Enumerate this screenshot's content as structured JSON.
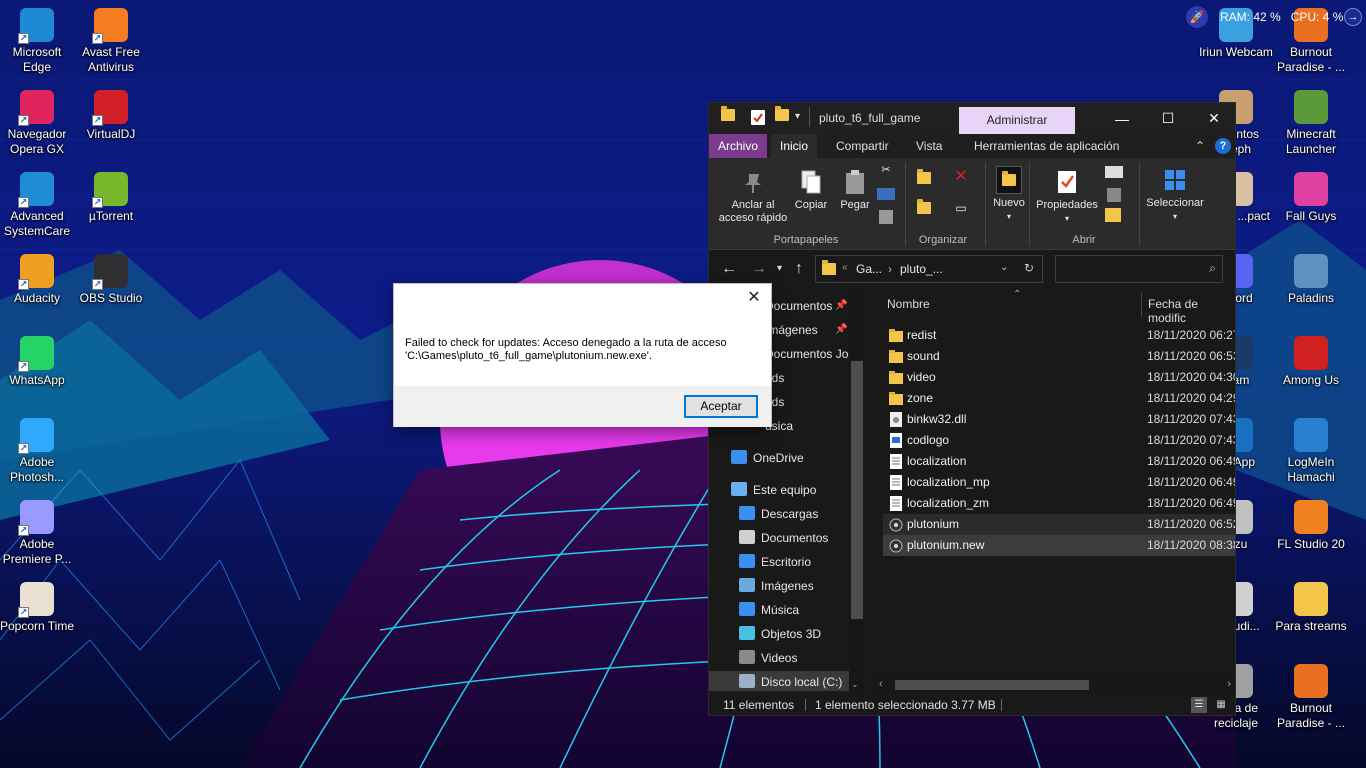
{
  "desktop": {
    "icons_left": [
      {
        "label": "Microsoft Edge",
        "icon": "edge-icon",
        "color": "#1e8ad6"
      },
      {
        "label": "Avast Free Antivirus",
        "icon": "avast-icon",
        "color": "#f57c20"
      },
      {
        "label": "Navegador Opera GX",
        "icon": "opera-gx-icon",
        "color": "#e0245e"
      },
      {
        "label": "VirtualDJ",
        "icon": "virtualdj-icon",
        "color": "#d31f26"
      },
      {
        "label": "Advanced SystemCare",
        "icon": "systemcare-icon",
        "color": "#1f8cd8"
      },
      {
        "label": "µTorrent",
        "icon": "utorrent-icon",
        "color": "#76b82a"
      },
      {
        "label": "Audacity",
        "icon": "audacity-icon",
        "color": "#f0a020"
      },
      {
        "label": "OBS Studio",
        "icon": "obs-icon",
        "color": "#302e31"
      },
      {
        "label": "WhatsApp",
        "icon": "whatsapp-icon",
        "color": "#25d366"
      },
      {
        "label": "Adobe Photosh...",
        "icon": "photoshop-icon",
        "color": "#31a8ff"
      },
      {
        "label": "Adobe Premiere P...",
        "icon": "premiere-icon",
        "color": "#9999ff"
      },
      {
        "label": "Popcorn Time",
        "icon": "popcorn-icon",
        "color": "#e8e0d0"
      }
    ],
    "icons_right": [
      {
        "label": "Iriun Webcam",
        "icon": "iriun-icon"
      },
      {
        "label": "Burnout Paradise - ...",
        "icon": "burnout-icon"
      },
      {
        "label": "...nentos ...eph",
        "icon": "folder-icon"
      },
      {
        "label": "Minecraft Launcher",
        "icon": "minecraft-icon"
      },
      {
        "label": "...shin ...pact",
        "icon": "genshin-icon"
      },
      {
        "label": "Fall Guys",
        "icon": "fallguys-icon"
      },
      {
        "label": "...cord",
        "icon": "discord-icon"
      },
      {
        "label": "Paladins",
        "icon": "paladins-icon"
      },
      {
        "label": "...am",
        "icon": "steam-icon"
      },
      {
        "label": "Among Us",
        "icon": "amongus-icon"
      },
      {
        "label": "...eApp",
        "icon": "app-icon"
      },
      {
        "label": "LogMeIn Hamachi",
        "icon": "hamachi-icon"
      },
      {
        "label": "...zu",
        "icon": "app-icon-2"
      },
      {
        "label": "FL Studio 20",
        "icon": "flstudio-icon"
      },
      {
        "label": "...Studi...",
        "icon": "studio-icon"
      },
      {
        "label": "Para streams",
        "icon": "folder-icon"
      },
      {
        "label": "...era de reciclaje",
        "icon": "recycle-bin-icon"
      },
      {
        "label": "Burnout Paradise - ...",
        "icon": "burnout-icon"
      }
    ]
  },
  "widget": {
    "ram": "RAM: 42 %",
    "cpu": "CPU: 4 %"
  },
  "explorer": {
    "title": "pluto_t6_full_game",
    "context_tab": "Administrar",
    "tabs": [
      "Archivo",
      "Inicio",
      "Compartir",
      "Vista",
      "Herramientas de aplicación"
    ],
    "ribbon": {
      "pin": "Anclar al acceso rápido",
      "copy": "Copiar",
      "paste": "Pegar",
      "new": "Nuevo",
      "properties": "Propiedades",
      "select": "Seleccionar",
      "groups": [
        "Portapapeles",
        "Organizar",
        "Abrir"
      ]
    },
    "address": {
      "part1": "Ga...",
      "part2": "pluto_..."
    },
    "nav": [
      {
        "label": "Documentos",
        "pinned": true,
        "icon": "documents-icon"
      },
      {
        "label": "Imágenes",
        "pinned": true,
        "icon": "pictures-icon"
      },
      {
        "label": "Documentos Jos",
        "pinned": false,
        "icon": "folder-icon"
      },
      {
        "label": "ods",
        "pinned": false,
        "icon": "folder-icon"
      },
      {
        "label": "ods",
        "pinned": false,
        "icon": "folder-icon"
      },
      {
        "label": "úsica",
        "pinned": false,
        "icon": "music-icon"
      },
      {
        "label": "OneDrive",
        "pinned": false,
        "icon": "onedrive-icon"
      },
      {
        "label": "Este equipo",
        "pinned": false,
        "icon": "computer-icon"
      },
      {
        "label": "Descargas",
        "pinned": false,
        "icon": "downloads-icon"
      },
      {
        "label": "Documentos",
        "pinned": false,
        "icon": "documents-icon"
      },
      {
        "label": "Escritorio",
        "pinned": false,
        "icon": "desktop-icon"
      },
      {
        "label": "Imágenes",
        "pinned": false,
        "icon": "pictures-icon"
      },
      {
        "label": "Música",
        "pinned": false,
        "icon": "music-icon"
      },
      {
        "label": "Objetos 3D",
        "pinned": false,
        "icon": "objects3d-icon"
      },
      {
        "label": "Videos",
        "pinned": false,
        "icon": "videos-icon"
      },
      {
        "label": "Disco local (C:)",
        "pinned": false,
        "icon": "drive-icon"
      }
    ],
    "columns": [
      "Nombre",
      "Fecha de modific"
    ],
    "files": [
      {
        "name": "redist",
        "date": "18/11/2020 06:27",
        "type": "folder"
      },
      {
        "name": "sound",
        "date": "18/11/2020 06:53",
        "type": "folder"
      },
      {
        "name": "video",
        "date": "18/11/2020 04:30",
        "type": "folder"
      },
      {
        "name": "zone",
        "date": "18/11/2020 04:29",
        "type": "folder"
      },
      {
        "name": "binkw32.dll",
        "date": "18/11/2020 07:43",
        "type": "dll"
      },
      {
        "name": "codlogo",
        "date": "18/11/2020 07:43",
        "type": "file"
      },
      {
        "name": "localization",
        "date": "18/11/2020 06:49",
        "type": "text"
      },
      {
        "name": "localization_mp",
        "date": "18/11/2020 06:49",
        "type": "text"
      },
      {
        "name": "localization_zm",
        "date": "18/11/2020 06:49",
        "type": "text"
      },
      {
        "name": "plutonium",
        "date": "18/11/2020 06:52",
        "type": "exe"
      },
      {
        "name": "plutonium.new",
        "date": "18/11/2020 08:38",
        "type": "exe"
      }
    ],
    "status": {
      "count": "11 elementos",
      "selected": "1 elemento seleccionado  3.77 MB"
    }
  },
  "dialog": {
    "message_line1": "Failed to check for updates: Acceso denegado a la ruta de acceso",
    "message_line2": "'C:\\Games\\pluto_t6_full_game\\plutonium.new.exe'.",
    "ok": "Aceptar",
    "close": "✕"
  }
}
